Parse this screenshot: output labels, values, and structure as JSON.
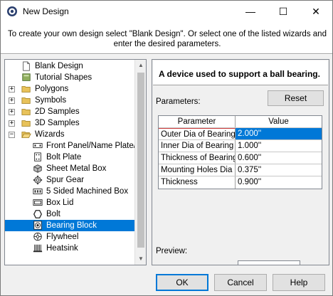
{
  "window": {
    "title": "New Design",
    "minimize_glyph": "—",
    "maximize_glyph": "☐",
    "close_glyph": "✕"
  },
  "instructions": "To create your own design select \"Blank Design\". Or select one of the listed wizards and enter the desired parameters.",
  "tree": {
    "items": [
      {
        "label": "Blank Design",
        "icon": "blank-page-icon",
        "expander": ""
      },
      {
        "label": "Tutorial Shapes",
        "icon": "book-icon",
        "expander": ""
      },
      {
        "label": "Polygons",
        "icon": "folder-icon",
        "expander": "+"
      },
      {
        "label": "Symbols",
        "icon": "folder-icon",
        "expander": "+"
      },
      {
        "label": "2D Samples",
        "icon": "folder-icon",
        "expander": "+"
      },
      {
        "label": "3D Samples",
        "icon": "folder-icon",
        "expander": "+"
      },
      {
        "label": "Wizards",
        "icon": "folder-open-icon",
        "expander": "−"
      },
      {
        "label": "Front Panel/Name Plate/",
        "icon": "panel-icon",
        "expander": ""
      },
      {
        "label": "Bolt Plate",
        "icon": "bolt-plate-icon",
        "expander": ""
      },
      {
        "label": "Sheet Metal Box",
        "icon": "sheet-metal-icon",
        "expander": ""
      },
      {
        "label": "Spur Gear",
        "icon": "gear-icon",
        "expander": ""
      },
      {
        "label": "5 Sided Machined Box",
        "icon": "machined-box-icon",
        "expander": ""
      },
      {
        "label": "Box Lid",
        "icon": "box-lid-icon",
        "expander": ""
      },
      {
        "label": "Bolt",
        "icon": "hexagon-icon",
        "expander": ""
      },
      {
        "label": "Bearing Block",
        "icon": "bearing-icon",
        "expander": ""
      },
      {
        "label": "Flywheel",
        "icon": "flywheel-icon",
        "expander": ""
      },
      {
        "label": "Heatsink",
        "icon": "heatsink-icon",
        "expander": ""
      }
    ],
    "selected": "Bearing Block"
  },
  "description": "A device used to support a ball bearing.",
  "parameters": {
    "label": "Parameters:",
    "reset_label": "Reset",
    "header": {
      "name": "Parameter",
      "value": "Value"
    },
    "rows": [
      {
        "name": "Outer Dia of Bearing",
        "value": "2.000''"
      },
      {
        "name": "Inner Dia of Bearing",
        "value": "1.000''"
      },
      {
        "name": "Thickness of Bearing",
        "value": "0.600''"
      },
      {
        "name": "Mounting Holes Dia",
        "value": "0.375''"
      },
      {
        "name": "Thickness",
        "value": "0.900''"
      }
    ],
    "selected_row": 0
  },
  "preview_label": "Preview:",
  "buttons": {
    "ok": "OK",
    "cancel": "Cancel",
    "help": "Help"
  },
  "colors": {
    "selection": "#0078d7"
  }
}
